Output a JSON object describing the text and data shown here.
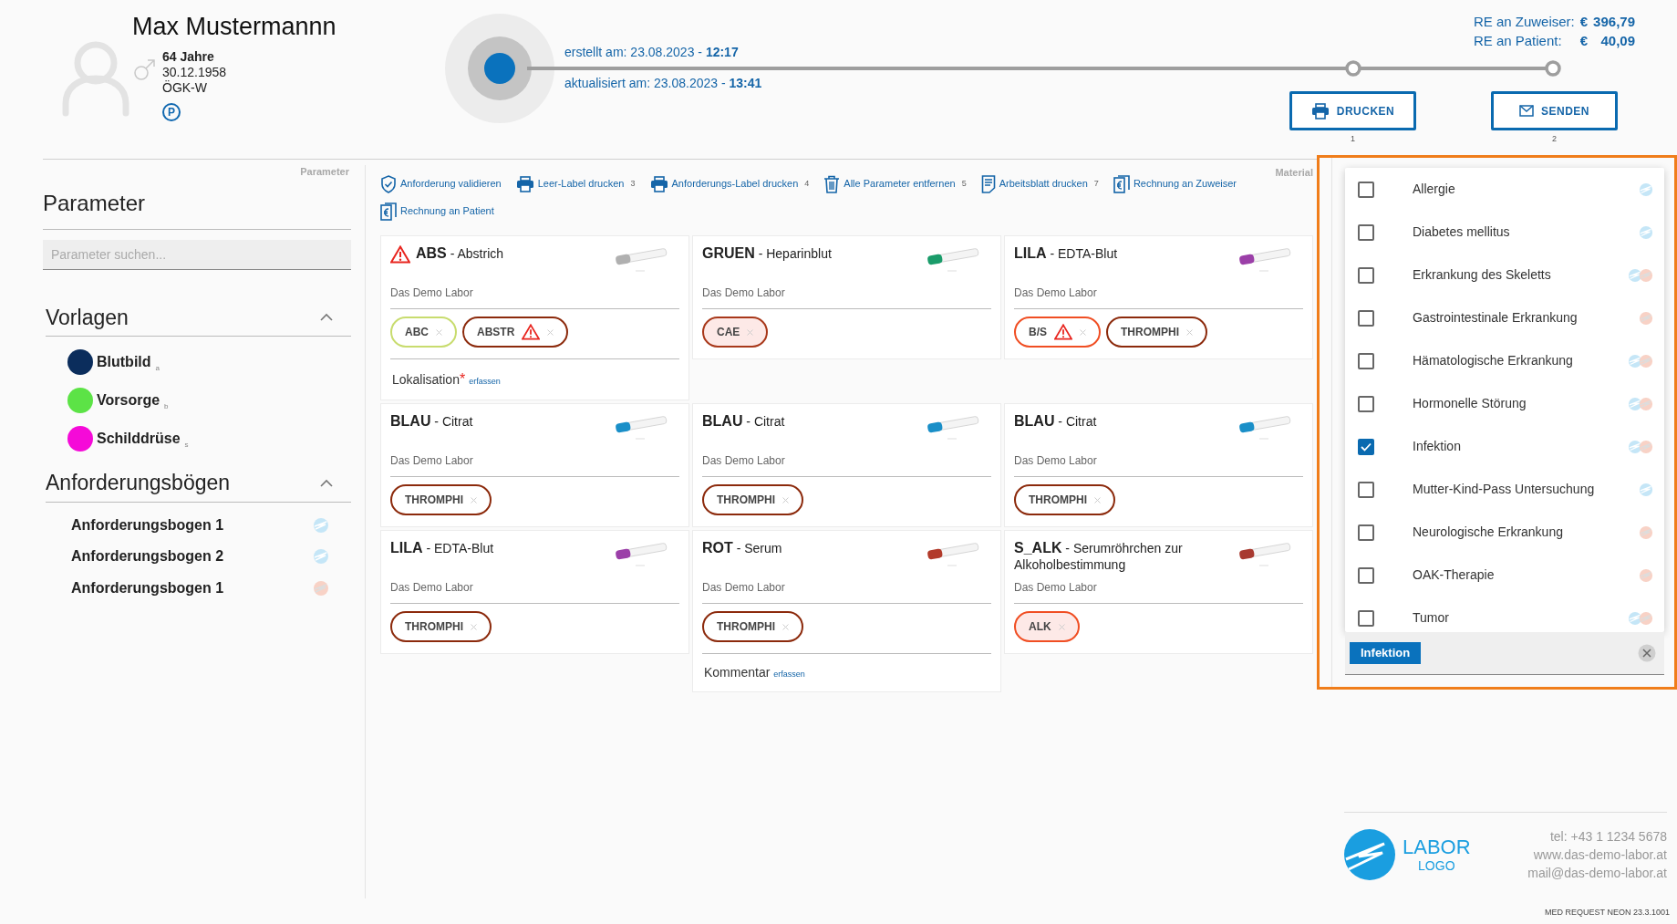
{
  "patient": {
    "name": "Max Mustermannn",
    "age": "64 Jahre",
    "birth_date": "30.12.1958",
    "insurance": "ÖGK-W",
    "badge": "P"
  },
  "timeline": {
    "created": "erstellt am: 23.08.2023 - **12:17**",
    "updated": "aktualisiert am: 23.08.2023 - **13:41**",
    "steps": [
      {
        "kind": "print",
        "label": "DRUCKEN",
        "number": "1"
      },
      {
        "kind": "mail",
        "label": "SENDEN",
        "number": "2"
      }
    ]
  },
  "invoices": [
    {
      "label": "RE an Zuweiser:",
      "currency": "€",
      "amount": "396,79"
    },
    {
      "label": "RE an Patient:",
      "currency": "€",
      "amount": "40,09"
    }
  ],
  "left_panel": {
    "section_label": "Parameter",
    "title": "Parameter",
    "search": {
      "placeholder": "Parameter suchen..."
    },
    "templates": {
      "title": "Vorlagen",
      "expanded": true,
      "items": [
        {
          "label": "Blutbild",
          "shortcut": "a",
          "color": "#0b2d5c"
        },
        {
          "label": "Vorsorge",
          "shortcut": "b",
          "color": "#5ce346"
        },
        {
          "label": "Schilddrüse",
          "shortcut": "s",
          "color": "#f50ad8"
        }
      ]
    },
    "forms": {
      "title": "Anforderungsbögen",
      "expanded": true,
      "items": [
        {
          "label": "Anforderungsbogen 1",
          "lab": {
            "kind": "primary"
          }
        },
        {
          "label": "Anforderungsbogen 2",
          "lab": {
            "kind": "primary"
          }
        },
        {
          "label": "Anforderungsbogen 1",
          "lab": {
            "kind": "secondary"
          }
        }
      ]
    }
  },
  "material": {
    "section_label": "Material",
    "toolbar": [
      {
        "kind": "validate",
        "label": "Anforderung validieren"
      },
      {
        "kind": "print",
        "label": "Leer-Label drucken",
        "shortcut": "3"
      },
      {
        "kind": "print",
        "label": "Anforderungs-Label drucken",
        "shortcut": "4"
      },
      {
        "kind": "delete",
        "label": "Alle Parameter entfernen",
        "shortcut": "5"
      },
      {
        "kind": "sheet",
        "label": "Arbeitsblatt drucken",
        "shortcut": "7"
      },
      {
        "kind": "invoice",
        "label": "Rechnung an Zuweiser"
      },
      {
        "kind": "invoice",
        "label": "Rechnung an Patient"
      }
    ],
    "cards": [
      {
        "code": "ABS",
        "material": "- Abstrich",
        "warning": true,
        "color": "#b0b0b0",
        "lab": "Das Demo Labor",
        "chips": [
          {
            "label": "ABC",
            "color": "#c8dc6e",
            "highlighted": false,
            "warning": false
          },
          {
            "label": "ABSTR",
            "color": "#8c2a0c",
            "highlighted": false,
            "warning": true
          }
        ],
        "note": {
          "label": "Lokalisation",
          "marker": "*",
          "link": "erfassen"
        }
      },
      {
        "code": "GRUEN",
        "material": "- Heparinblut",
        "warning": false,
        "color": "#1a9c6a",
        "lab": "Das Demo Labor",
        "chips": [
          {
            "label": "CAE",
            "color": "#a8381a",
            "highlighted": true,
            "warning": false
          }
        ]
      },
      {
        "code": "LILA",
        "material": "- EDTA-Blut",
        "warning": false,
        "color": "#9b3fa8",
        "lab": "Das Demo Labor",
        "chips": [
          {
            "label": "B/S",
            "color": "#f04e23",
            "highlighted": false,
            "warning": true
          },
          {
            "label": "THROMPHI",
            "color": "#8c2a0c",
            "highlighted": false,
            "warning": false
          }
        ]
      },
      {
        "code": "BLAU",
        "material": "- Citrat",
        "warning": false,
        "color": "#1a8fc8",
        "lab": "Das Demo Labor",
        "chips": [
          {
            "label": "THROMPHI",
            "color": "#8c2a0c",
            "highlighted": false,
            "warning": false
          }
        ]
      },
      {
        "code": "BLAU",
        "material": "- Citrat",
        "warning": false,
        "color": "#1a8fc8",
        "lab": "Das Demo Labor",
        "chips": [
          {
            "label": "THROMPHI",
            "color": "#8c2a0c",
            "highlighted": false,
            "warning": false
          }
        ]
      },
      {
        "code": "BLAU",
        "material": "- Citrat",
        "warning": false,
        "color": "#1a8fc8",
        "lab": "Das Demo Labor",
        "chips": [
          {
            "label": "THROMPHI",
            "color": "#8c2a0c",
            "highlighted": false,
            "warning": false
          }
        ]
      },
      {
        "code": "LILA",
        "material": "- EDTA-Blut",
        "warning": false,
        "color": "#9b3fa8",
        "lab": "Das Demo Labor",
        "chips": [
          {
            "label": "THROMPHI",
            "color": "#8c2a0c",
            "highlighted": false,
            "warning": false
          }
        ]
      },
      {
        "code": "ROT",
        "material": "- Serum",
        "warning": false,
        "color": "#b23a2a",
        "lab": "Das Demo Labor",
        "chips": [
          {
            "label": "THROMPHI",
            "color": "#8c2a0c",
            "highlighted": false,
            "warning": false
          }
        ],
        "note": {
          "label": "Kommentar",
          "link": "erfassen"
        }
      },
      {
        "code": "S_ALK",
        "material": "- Serumröhrchen zur Alkoholbestimmung",
        "warning": false,
        "color": "#a83a30",
        "lab": "Das Demo Labor",
        "chips": [
          {
            "label": "ALK",
            "color": "#f04e23",
            "highlighted": true,
            "warning": false
          }
        ]
      }
    ]
  },
  "information": {
    "options": [
      {
        "label": "Allergie",
        "checked": false,
        "labs": [
          {
            "kind": "primary"
          }
        ]
      },
      {
        "label": "Diabetes mellitus",
        "checked": false,
        "labs": [
          {
            "kind": "primary"
          }
        ]
      },
      {
        "label": "Erkrankung des Skeletts",
        "checked": false,
        "labs": [
          {
            "kind": "primary"
          },
          {
            "kind": "secondary"
          }
        ]
      },
      {
        "label": "Gastrointestinale Erkrankung",
        "checked": false,
        "labs": [
          {
            "kind": "secondary"
          }
        ]
      },
      {
        "label": "Hämatologische Erkrankung",
        "checked": false,
        "labs": [
          {
            "kind": "primary"
          },
          {
            "kind": "secondary"
          }
        ]
      },
      {
        "label": "Hormonelle Störung",
        "checked": false,
        "labs": [
          {
            "kind": "primary"
          },
          {
            "kind": "secondary"
          }
        ]
      },
      {
        "label": "Infektion",
        "checked": true,
        "labs": [
          {
            "kind": "primary"
          },
          {
            "kind": "secondary"
          }
        ]
      },
      {
        "label": "Mutter-Kind-Pass Untersuchung",
        "checked": false,
        "labs": [
          {
            "kind": "primary"
          }
        ]
      },
      {
        "label": "Neurologische Erkrankung",
        "checked": false,
        "labs": [
          {
            "kind": "secondary"
          }
        ]
      },
      {
        "label": "OAK-Therapie",
        "checked": false,
        "labs": [
          {
            "kind": "secondary"
          }
        ]
      },
      {
        "label": "Tumor",
        "checked": false,
        "labs": [
          {
            "kind": "primary"
          },
          {
            "kind": "secondary"
          }
        ]
      }
    ],
    "selected_chips": [
      {
        "label": "Infektion"
      }
    ]
  },
  "footer": {
    "logo": {
      "line1": "LABOR",
      "line2": "LOGO"
    },
    "contact": [
      "tel: +43 1 1234 5678",
      "www.das-demo-labor.at",
      "mail@das-demo-labor.at"
    ],
    "version": "MED REQUEST NEON 23.3.1001"
  }
}
